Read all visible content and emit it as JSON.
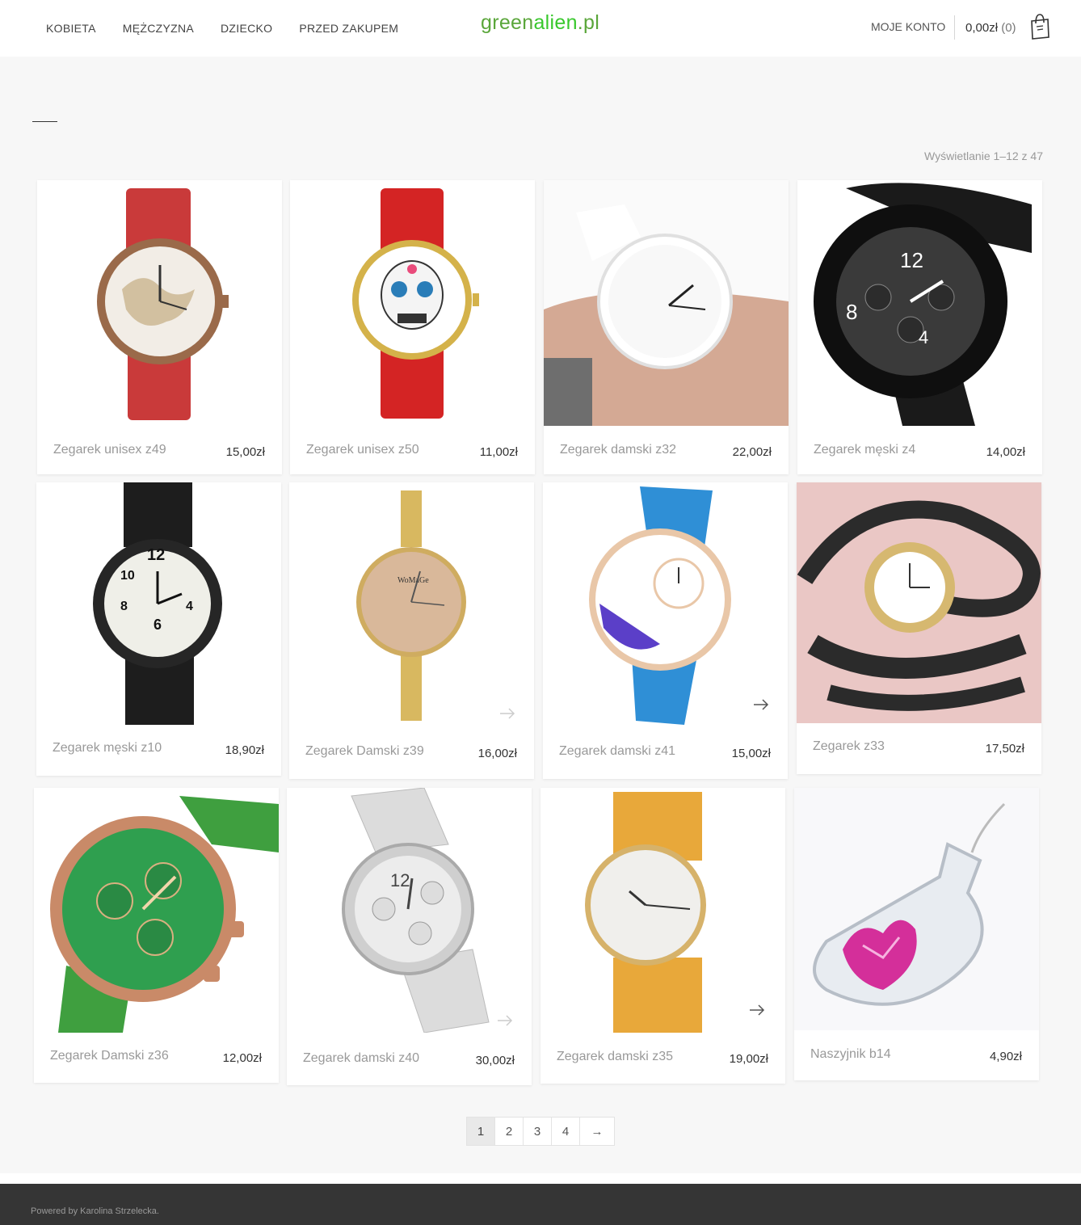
{
  "nav": {
    "items": [
      "KOBIETA",
      "MĘŻCZYZNA",
      "DZIECKO",
      "PRZED ZAKUPEM"
    ]
  },
  "logo": {
    "part1": "green",
    "part2": "alien",
    "part3": ".pl"
  },
  "header": {
    "account": "MOJE KONTO",
    "cart_total": "0,00zł",
    "cart_count": "(0)"
  },
  "result_count": "Wyświetlanie 1–12 z 47",
  "products": [
    {
      "name": "Zegarek unisex z49",
      "price": "15,00zł"
    },
    {
      "name": "Zegarek unisex z50",
      "price": "11,00zł"
    },
    {
      "name": "Zegarek damski z32",
      "price": "22,00zł"
    },
    {
      "name": "Zegarek męski z4",
      "price": "14,00zł"
    },
    {
      "name": "Zegarek męski z10",
      "price": "18,90zł"
    },
    {
      "name": "Zegarek Damski z39",
      "price": "16,00zł"
    },
    {
      "name": "Zegarek damski z41",
      "price": "15,00zł"
    },
    {
      "name": "Zegarek z33",
      "price": "17,50zł"
    },
    {
      "name": "Zegarek Damski z36",
      "price": "12,00zł"
    },
    {
      "name": "Zegarek damski z40",
      "price": "30,00zł"
    },
    {
      "name": "Zegarek damski z35",
      "price": "19,00zł"
    },
    {
      "name": "Naszyjnik b14",
      "price": "4,90zł"
    }
  ],
  "pagination": {
    "pages": [
      "1",
      "2",
      "3",
      "4"
    ],
    "next": "→",
    "current": "1"
  },
  "footer": {
    "powered": "Powered by Karolina Strzelecka."
  },
  "colors": {
    "logo_green": "#38c82c",
    "footer_bg": "#353535",
    "page_bg": "#f7f7f7"
  }
}
